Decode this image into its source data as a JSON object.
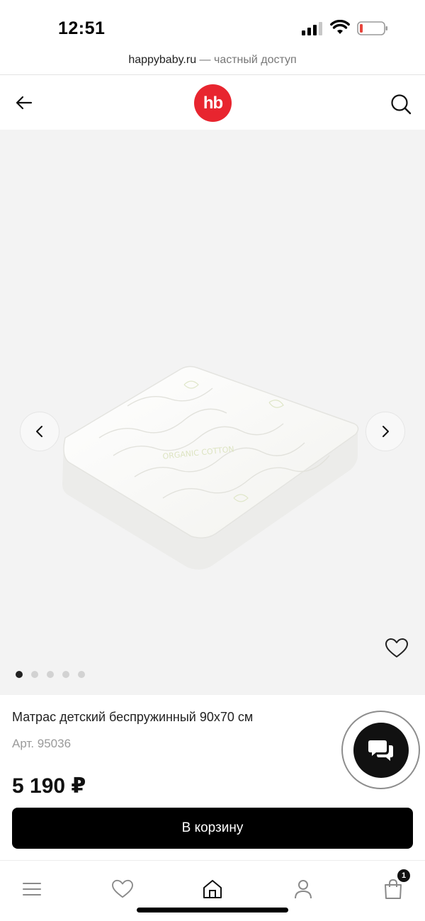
{
  "status_bar": {
    "time": "12:51",
    "icons": [
      "cellular-signal-icon",
      "wifi-icon",
      "battery-low-icon"
    ],
    "battery_color": "#e8453c"
  },
  "url_bar": {
    "domain": "happybaby.ru",
    "note": " — частный доступ"
  },
  "header": {
    "logo_text": "hb",
    "logo_color": "#e8252f",
    "back_icon": "arrow-left-icon",
    "search_icon": "search-icon"
  },
  "gallery": {
    "image_label": "ORGANIC COTTON",
    "image_count": 5,
    "active_index": 0,
    "prev_icon": "chevron-left-icon",
    "next_icon": "chevron-right-icon",
    "favorite_icon": "heart-outline-icon"
  },
  "product": {
    "title": "Матрас детский беспружинный 90х70 см",
    "sku": "Арт. 95036",
    "price": "5 190 ₽"
  },
  "actions": {
    "add_to_cart": "В корзину",
    "chat_icon": "chat-bubbles-icon"
  },
  "bottom_nav": {
    "items": [
      {
        "icon": "menu-icon"
      },
      {
        "icon": "heart-icon"
      },
      {
        "icon": "home-icon"
      },
      {
        "icon": "user-icon"
      },
      {
        "icon": "shopping-bag-icon",
        "badge": "1"
      }
    ]
  }
}
